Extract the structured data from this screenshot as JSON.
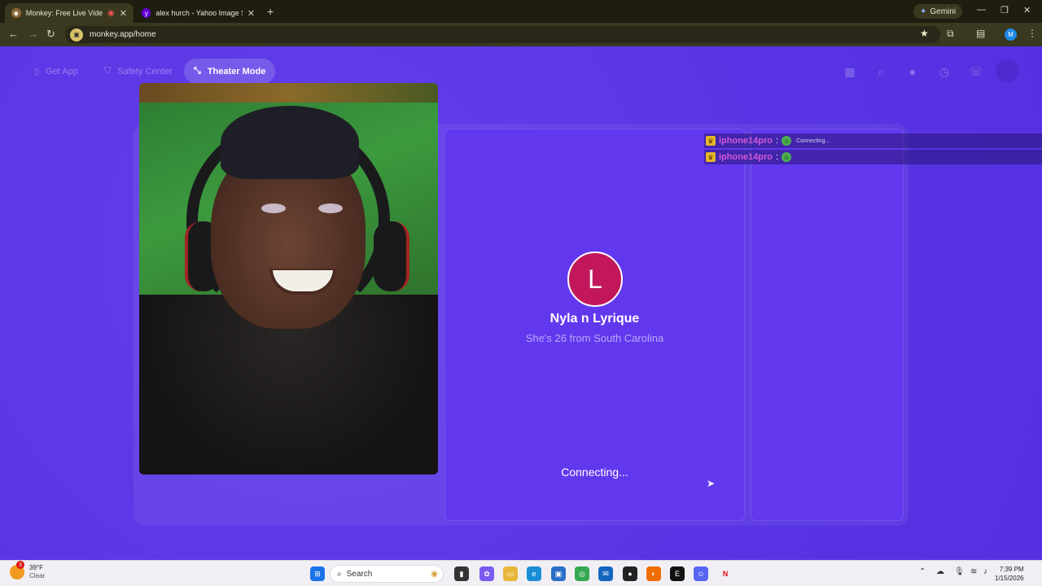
{
  "browser": {
    "tabs": [
      {
        "title": "Monkey: Free Live Video Ch",
        "active": true
      },
      {
        "title": "alex hurch - Yahoo Image Searc",
        "active": false
      }
    ],
    "gemini_label": "Gemini",
    "url": "monkey.app/home",
    "profile_initial": "M"
  },
  "header": {
    "get_app": "Get App",
    "safety_center": "Safety Center",
    "theater_mode": "Theater Mode"
  },
  "match": {
    "avatar_letter": "L",
    "name": "Nyla n Lyrique",
    "description": "She's 26 from South Carolina",
    "status": "Connecting..."
  },
  "overlay": {
    "rows": [
      {
        "username": "iphone14pro",
        "colon": ":",
        "status_text": "Connecting..."
      },
      {
        "username": "iphone14pro",
        "colon": ":",
        "status_text": ""
      }
    ]
  },
  "taskbar": {
    "weather_badge": "3",
    "temperature": "39°F",
    "condition": "Clear",
    "search_label": "Search",
    "time": "7:39 PM",
    "date": "1/15/2026"
  },
  "colors": {
    "page_bg": "#5b35e6",
    "avatar_bg": "#c2185b",
    "username": "#d25ad8"
  }
}
